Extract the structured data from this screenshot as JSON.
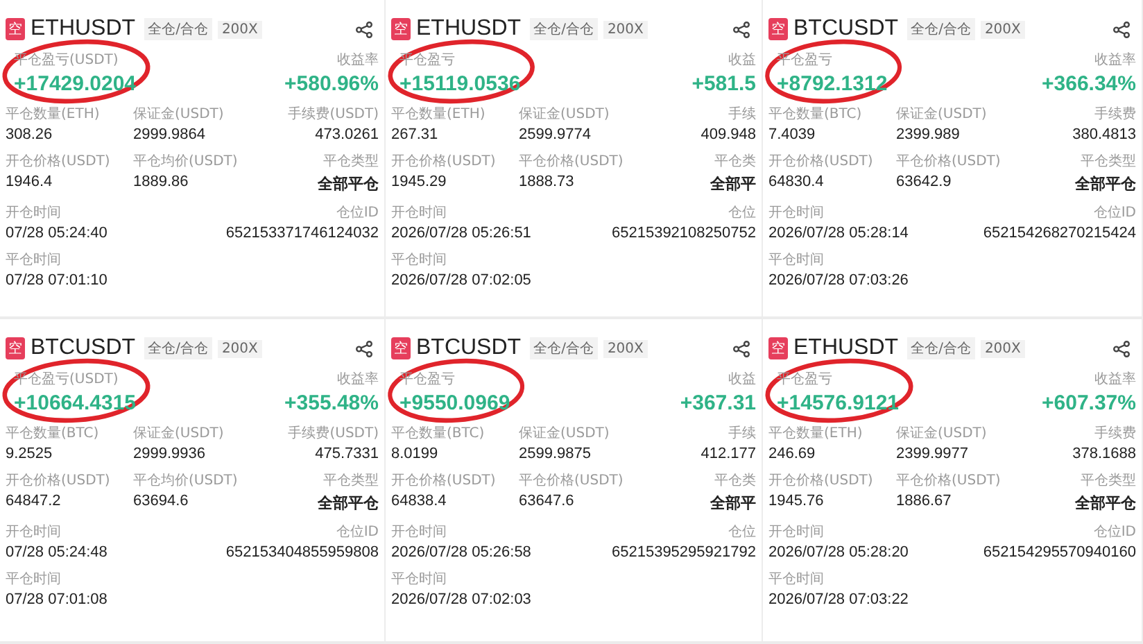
{
  "cards": [
    {
      "badge": "空",
      "symbol": "ETHUSDT",
      "tags": [
        "全仓/合仓",
        "200X"
      ],
      "pnl_label": "平仓盈亏(USDT)",
      "pnl": "+17429.0204",
      "circled": true,
      "rate_label": "收益率",
      "rate": "+580.96%",
      "metrics": [
        {
          "label": "平仓数量(ETH)",
          "value": "308.26"
        },
        {
          "label": "保证金(USDT)",
          "value": "2999.9864"
        },
        {
          "label": "手续费(USDT)",
          "value": "473.0261"
        }
      ],
      "prices": [
        {
          "label": "开仓价格(USDT)",
          "value": "1946.4"
        },
        {
          "label": "平仓均价(USDT)",
          "value": "1889.86"
        },
        {
          "label": "平仓类型",
          "value": "全部平仓"
        }
      ],
      "open_time": {
        "label": "开仓时间",
        "value": "07/28 05:24:40"
      },
      "position_id": {
        "label": "仓位ID",
        "value": "652153371746124032"
      },
      "close_time": {
        "label": "平仓时间",
        "value": "07/28 07:01:10"
      }
    },
    {
      "badge": "空",
      "symbol": "ETHUSDT",
      "tags": [
        "全仓/合仓",
        "200X"
      ],
      "pnl_label": "平仓盈亏",
      "pnl": "+15119.0536",
      "circled": true,
      "rate_label": "收益",
      "rate": "+581.5",
      "metrics": [
        {
          "label": "平仓数量(ETH)",
          "value": "267.31"
        },
        {
          "label": "保证金(USDT)",
          "value": "2599.9774"
        },
        {
          "label": "手续",
          "value": "409.948"
        }
      ],
      "prices": [
        {
          "label": "开仓价格(USDT)",
          "value": "1945.29"
        },
        {
          "label": "平仓价格(USDT)",
          "value": "1888.73"
        },
        {
          "label": "平仓类",
          "value": "全部平"
        }
      ],
      "open_time": {
        "label": "开仓时间",
        "value": "2026/07/28 05:26:51"
      },
      "position_id": {
        "label": "仓位",
        "value": "65215392108250752"
      },
      "close_time": {
        "label": "平仓时间",
        "value": "2026/07/28 07:02:05"
      }
    },
    {
      "badge": "空",
      "symbol": "BTCUSDT",
      "tags": [
        "全仓/合仓",
        "200X"
      ],
      "pnl_label": "平仓盈亏",
      "pnl": "+8792.1312",
      "circled": true,
      "rate_label": "收益率",
      "rate": "+366.34%",
      "metrics": [
        {
          "label": "平仓数量(BTC)",
          "value": "7.4039"
        },
        {
          "label": "保证金(USDT)",
          "value": "2399.989"
        },
        {
          "label": "手续费",
          "value": "380.4813"
        }
      ],
      "prices": [
        {
          "label": "开仓价格(USDT)",
          "value": "64830.4"
        },
        {
          "label": "平仓价格(USDT)",
          "value": "63642.9"
        },
        {
          "label": "平仓类型",
          "value": "全部平仓"
        }
      ],
      "open_time": {
        "label": "开仓时间",
        "value": "2026/07/28 05:28:14"
      },
      "position_id": {
        "label": "仓位ID",
        "value": "652154268270215424"
      },
      "close_time": {
        "label": "平仓时间",
        "value": "2026/07/28 07:03:26"
      }
    },
    {
      "badge": "空",
      "symbol": "BTCUSDT",
      "tags": [
        "全仓/合仓",
        "200X"
      ],
      "pnl_label": "平仓盈亏(USDT)",
      "pnl": "+10664.4315",
      "circled": true,
      "rate_label": "收益率",
      "rate": "+355.48%",
      "metrics": [
        {
          "label": "平仓数量(BTC)",
          "value": "9.2525"
        },
        {
          "label": "保证金(USDT)",
          "value": "2999.9936"
        },
        {
          "label": "手续费(USDT)",
          "value": "475.7331"
        }
      ],
      "prices": [
        {
          "label": "开仓价格(USDT)",
          "value": "64847.2"
        },
        {
          "label": "平仓均价(USDT)",
          "value": "63694.6"
        },
        {
          "label": "平仓类型",
          "value": "全部平仓"
        }
      ],
      "open_time": {
        "label": "开仓时间",
        "value": "07/28 05:24:48"
      },
      "position_id": {
        "label": "仓位ID",
        "value": "652153404855959808"
      },
      "close_time": {
        "label": "平仓时间",
        "value": "07/28 07:01:08"
      }
    },
    {
      "badge": "空",
      "symbol": "BTCUSDT",
      "tags": [
        "全仓/合仓",
        "200X"
      ],
      "pnl_label": "平仓盈亏",
      "pnl": "+9550.0969",
      "circled": true,
      "rate_label": "收益",
      "rate": "+367.31",
      "metrics": [
        {
          "label": "平仓数量(BTC)",
          "value": "8.0199"
        },
        {
          "label": "保证金(USDT)",
          "value": "2599.9875"
        },
        {
          "label": "手续",
          "value": "412.177"
        }
      ],
      "prices": [
        {
          "label": "开仓价格(USDT)",
          "value": "64838.4"
        },
        {
          "label": "平仓价格(USDT)",
          "value": "63647.6"
        },
        {
          "label": "平仓类",
          "value": "全部平"
        }
      ],
      "open_time": {
        "label": "开仓时间",
        "value": "2026/07/28 05:26:58"
      },
      "position_id": {
        "label": "仓位",
        "value": "65215395295921792"
      },
      "close_time": {
        "label": "平仓时间",
        "value": "2026/07/28 07:02:03"
      }
    },
    {
      "badge": "空",
      "symbol": "ETHUSDT",
      "tags": [
        "全仓/合仓",
        "200X"
      ],
      "pnl_label": "平仓盈亏",
      "pnl": "+14576.9121",
      "circled": true,
      "rate_label": "收益率",
      "rate": "+607.37%",
      "metrics": [
        {
          "label": "平仓数量(ETH)",
          "value": "246.69"
        },
        {
          "label": "保证金(USDT)",
          "value": "2399.9977"
        },
        {
          "label": "手续费",
          "value": "378.1688"
        }
      ],
      "prices": [
        {
          "label": "开仓价格(USDT)",
          "value": "1945.76"
        },
        {
          "label": "平仓价格(USDT)",
          "value": "1886.67"
        },
        {
          "label": "平仓类型",
          "value": "全部平仓"
        }
      ],
      "open_time": {
        "label": "开仓时间",
        "value": "2026/07/28 05:28:20"
      },
      "position_id": {
        "label": "仓位ID",
        "value": "652154295570940160"
      },
      "close_time": {
        "label": "平仓时间",
        "value": "2026/07/28 07:03:22"
      }
    }
  ]
}
